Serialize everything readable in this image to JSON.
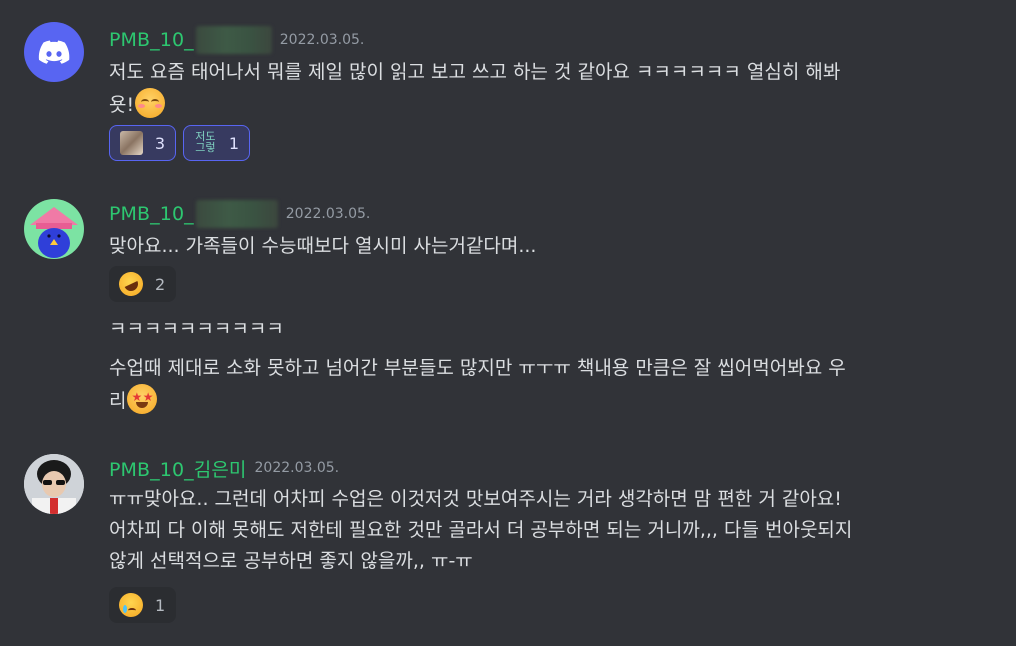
{
  "messages": [
    {
      "author": "PMB_10_",
      "timestamp": "2022.03.05.",
      "line1": "저도 요즘 태어나서 뭐를 제일 많이 읽고 보고 쓰고 하는 것 같아요 ㅋㅋㅋㅋㅋㅋ 열심히 해봐",
      "line2": "욧!",
      "emoji": "smiling-face-with-blush",
      "reactions": [
        {
          "icon": "cat-photo-emoji",
          "count": "3"
        },
        {
          "icon": "text-sticker-emoji",
          "sticker_text": "저도 그렇",
          "count": "1"
        }
      ]
    },
    {
      "author": "PMB_10_",
      "timestamp": "2022.03.05.",
      "line1": "맞아요... 가족들이 수능때보다 열시미 사는거같다며...",
      "reactions": [
        {
          "icon": "rolling-on-floor-laughing",
          "count": "2"
        }
      ],
      "followups": [
        {
          "text": "ㅋㅋㅋㅋㅋㅋㅋㅋㅋㅋ"
        },
        {
          "line1": "수업때 제대로 소화 못하고 넘어간 부분들도 많지만 ㅠㅜㅠ  책내용 만큼은 잘 씹어먹어봐요 우",
          "line2": "리",
          "emoji": "star-struck"
        }
      ]
    },
    {
      "author": "PMB_10_김은미",
      "timestamp": "2022.03.05.",
      "line1": "ㅠㅠ맞아요.. 그런데 어차피 수업은 이것저것 맛보여주시는 거라 생각하면 맘 편한 거 같아요!",
      "line2": "어차피 다 이해 못해도 저한테 필요한 것만 골라서 더 공부하면 되는 거니까,,, 다들 번아웃되지",
      "line3": "않게 선택적으로 공부하면 좋지 않을까,, ㅠ-ㅠ",
      "reactions": [
        {
          "icon": "smiling-face-with-tear",
          "count": "1"
        }
      ]
    }
  ]
}
